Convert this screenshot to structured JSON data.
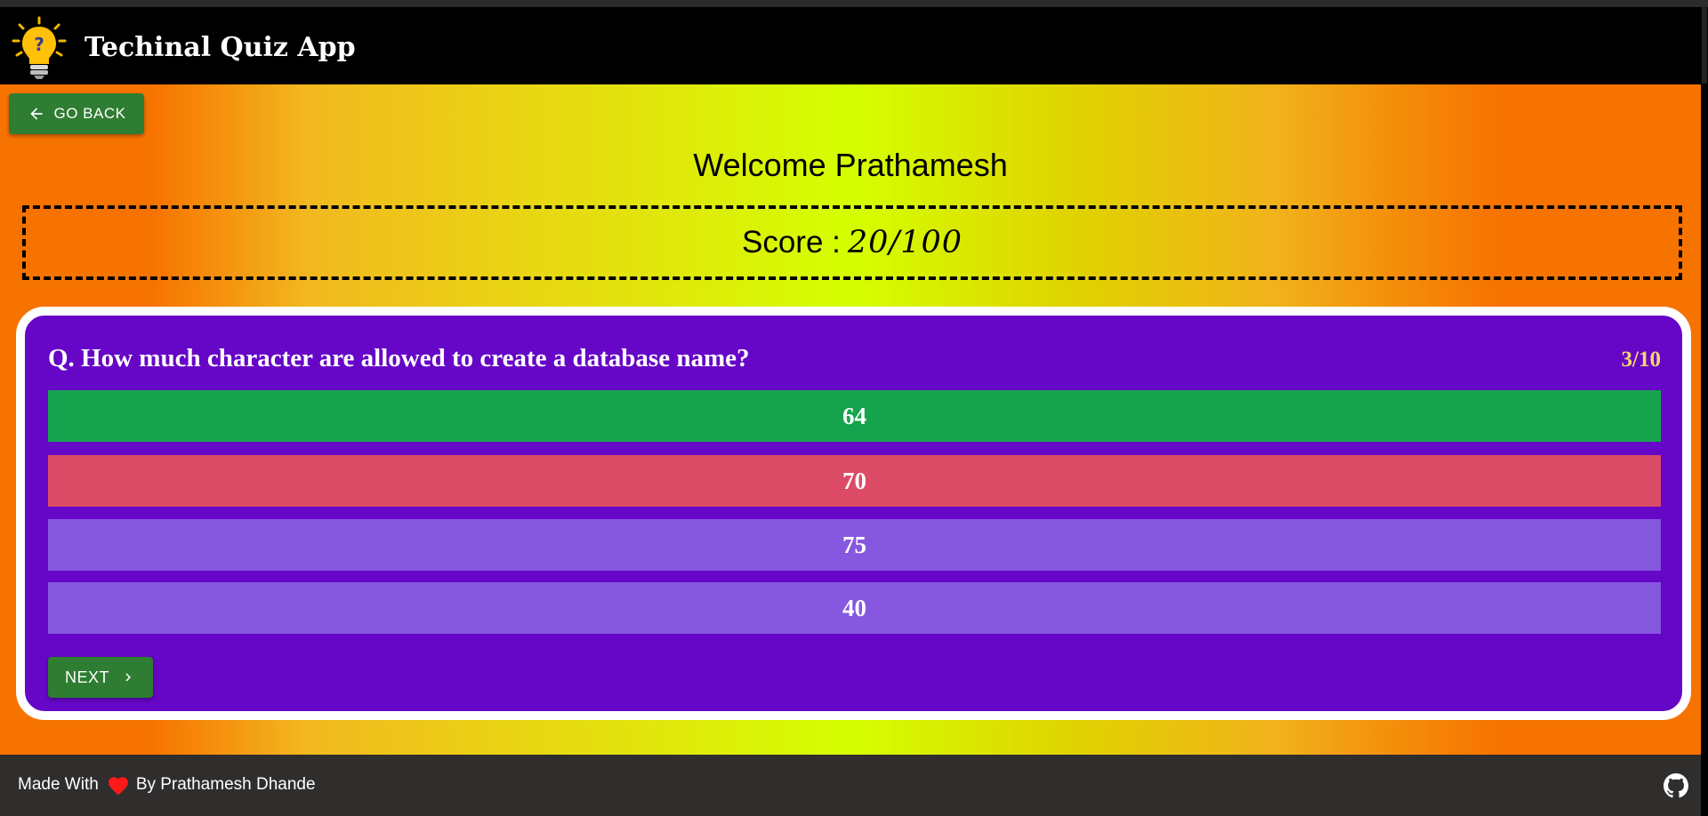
{
  "header": {
    "app_title": "Techinal Quiz App",
    "logo_icon": "lightbulb-question-icon"
  },
  "nav": {
    "go_back_label": "GO BACK",
    "go_back_icon": "arrow-left-icon"
  },
  "welcome": {
    "text": "Welcome Prathamesh"
  },
  "score": {
    "label": "Score :",
    "value": "20/100"
  },
  "quiz": {
    "question": "Q. How much character are allowed to create a database name?",
    "counter": "3/10",
    "options": [
      {
        "label": "64",
        "state": "correct"
      },
      {
        "label": "70",
        "state": "wrong"
      },
      {
        "label": "75",
        "state": "default"
      },
      {
        "label": "40",
        "state": "default"
      }
    ],
    "next_label": "NEXT",
    "next_icon": "chevron-right-icon"
  },
  "footer": {
    "made_with": "Made With",
    "by_author": "By Prathamesh Dhande",
    "heart_icon": "heart-icon",
    "github_icon": "github-icon"
  },
  "colors": {
    "navbar": "#000000",
    "button_green": "#2e7d32",
    "card_purple": "#6606c7",
    "correct": "#16a34e",
    "wrong": "#dc4b66",
    "option_default": "#8657df",
    "counter": "#f5d76e",
    "footer": "#302d2d"
  }
}
